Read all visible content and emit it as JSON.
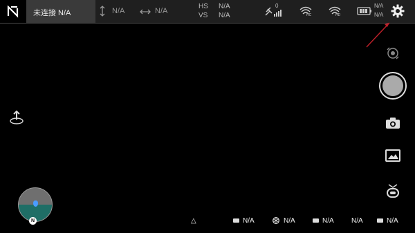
{
  "topbar": {
    "connection_status": "未连接 N/A",
    "altitude_value": "N/A",
    "distance_value": "N/A",
    "hs_label": "HS",
    "hs_value": "N/A",
    "vs_label": "VS",
    "vs_value": "N/A",
    "gps_count": "0",
    "battery_top": "N/A",
    "battery_bottom": "N/A",
    "icons": [
      "app-logo-icon",
      "vertical-arrows-icon",
      "horizontal-arrows-icon",
      "satellite-icon",
      "rc-signal-icon",
      "video-signal-icon",
      "battery-icon",
      "settings-gear-icon"
    ]
  },
  "right_panel": {
    "icons": [
      "camera-switch-icon",
      "shutter-button",
      "camera-mode-icon",
      "gallery-icon",
      "gimbal-icon"
    ]
  },
  "left_panel": {
    "icons": [
      "takeoff-icon"
    ]
  },
  "radar": {
    "north_label": "N"
  },
  "bottom_bar": {
    "home_icon": "triangle-icon",
    "items": [
      {
        "label": "N/A"
      },
      {
        "label": "N/A"
      },
      {
        "label": "N/A"
      },
      {
        "label": "N/A"
      },
      {
        "label": "N/A"
      }
    ]
  },
  "colors": {
    "annotation_arrow": "#c0202a",
    "ground": "#1f6e66",
    "sky": "#6f6f6f",
    "drone_dot": "#4a9cff"
  }
}
